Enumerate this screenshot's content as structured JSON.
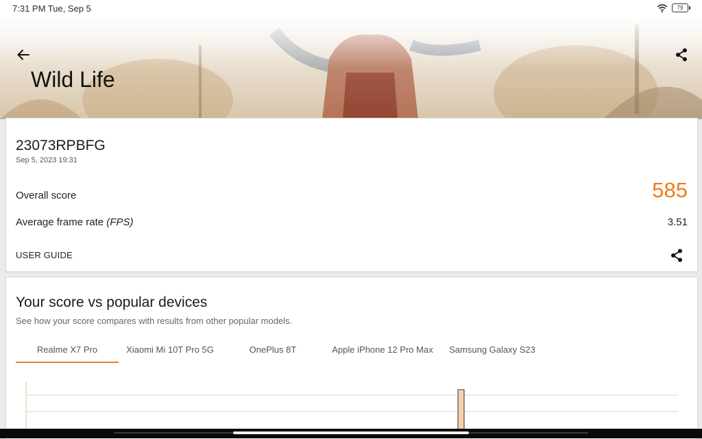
{
  "status": {
    "time": "7:31 PM Tue, Sep 5",
    "battery": "79"
  },
  "header": {
    "title": "Wild Life"
  },
  "result": {
    "device": "23073RPBFG",
    "datetime": "Sep 5, 2023 19:31",
    "overall_label": "Overall score",
    "overall_score": "585",
    "fps_label": "Average frame rate ",
    "fps_unit": "(FPS)",
    "fps_value": "3.51",
    "user_guide": "USER GUIDE"
  },
  "comparison": {
    "title": "Your score vs popular devices",
    "subtitle": "See how your score compares with results from other popular models.",
    "tabs": [
      "Realme X7 Pro",
      "Xiaomi Mi 10T Pro 5G",
      "OnePlus 8T",
      "Apple iPhone 12 Pro Max",
      "Samsung Galaxy S23"
    ],
    "active_tab": 0
  },
  "colors": {
    "accent": "#ee7b1e",
    "bar": "#f6cfae"
  }
}
